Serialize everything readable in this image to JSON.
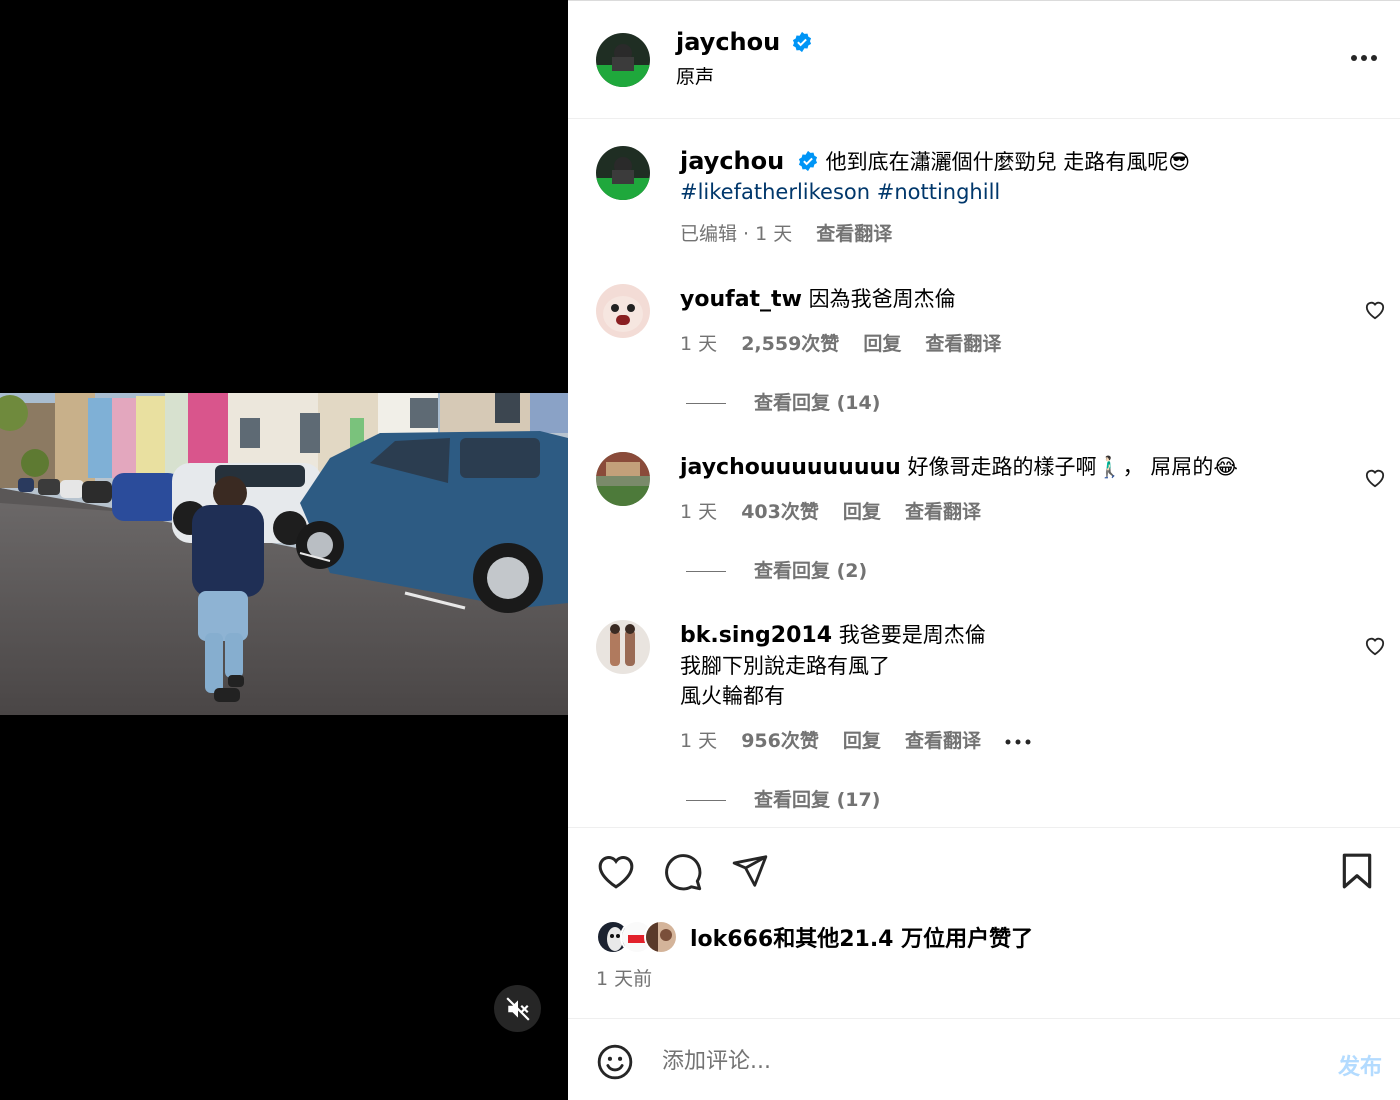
{
  "post": {
    "username": "jaychou",
    "audio": "原声",
    "caption": "他到底在瀟灑個什麼勁兒 走路有風呢😎",
    "hashtags": "#likefatherlikeson #nottinghill",
    "caption_meta": "已编辑 · 1 天",
    "see_translation": "查看翻译"
  },
  "comments": [
    {
      "username": "youfat_tw",
      "text": "因為我爸周杰倫",
      "time": "1 天",
      "likes": "2,559次赞",
      "reply": "回复",
      "translate": "查看翻译",
      "view_replies": "查看回复 (14)"
    },
    {
      "username": "jaychouuuuuuuuu",
      "text": "好像哥走路的樣子啊🚶🏻‍♂️， 屌屌的😂",
      "time": "1 天",
      "likes": "403次赞",
      "reply": "回复",
      "translate": "查看翻译",
      "view_replies": "查看回复 (2)"
    },
    {
      "username": "bk.sing2014",
      "text_line1": "我爸要是周杰倫",
      "text_line2": "我腳下別說走路有風了",
      "text_line3": "風火輪都有",
      "time": "1 天",
      "likes": "956次赞",
      "reply": "回复",
      "translate": "查看翻译",
      "view_replies": "查看回复 (17)"
    }
  ],
  "likes_summary": "lok666和其他21.4 万位用户赞了",
  "posted_ago": "1 天前",
  "add_comment": {
    "placeholder": "添加评论...",
    "post_label": "发布"
  },
  "colors": {
    "verified": "#0095f6",
    "muted_text": "#737373",
    "hashtag": "#00376b",
    "post_button_disabled": "#b3dbff"
  }
}
